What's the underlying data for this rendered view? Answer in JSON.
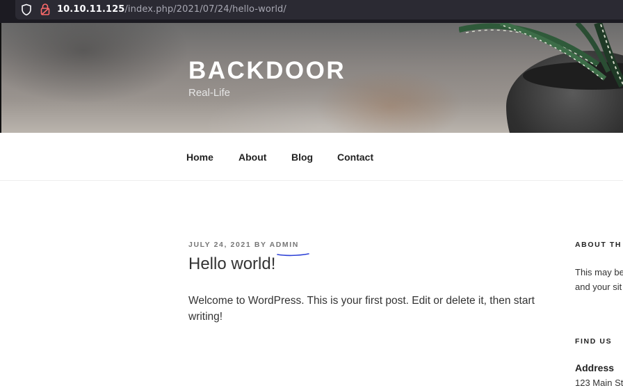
{
  "browser": {
    "url_host": "10.10.11.125",
    "url_path": "/index.php/2021/07/24/hello-world/"
  },
  "site": {
    "title": "BACKDOOR",
    "tagline": "Real-Life"
  },
  "nav": {
    "items": [
      {
        "label": "Home"
      },
      {
        "label": "About"
      },
      {
        "label": "Blog"
      },
      {
        "label": "Contact"
      }
    ]
  },
  "post": {
    "date": "JULY 24, 2021",
    "by": "BY",
    "author": "ADMIN",
    "title": "Hello world!",
    "body": "Welcome to WordPress. This is your first post. Edit or delete it, then start writing!"
  },
  "sidebar": {
    "about_heading": "ABOUT TH",
    "about_text_line1": "This may be",
    "about_text_line2": "and your sit",
    "find_heading": "FIND US",
    "address_heading": "Address",
    "address_line": "123 Main St"
  },
  "colors": {
    "browser_bg": "#1c1b22",
    "url_field_bg": "#2b2a33",
    "annotation_underline": "#2b3fd6"
  }
}
